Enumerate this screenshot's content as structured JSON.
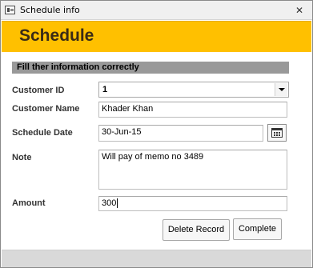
{
  "window": {
    "title": "Schedule info",
    "close_glyph": "✕"
  },
  "header": {
    "title": "Schedule"
  },
  "section": {
    "title": "Fill ther information correctly"
  },
  "form": {
    "customer_id": {
      "label": "Customer ID",
      "value": "1"
    },
    "customer_name": {
      "label": "Customer  Name",
      "value": "Khader Khan"
    },
    "schedule_date": {
      "label": "Schedule Date",
      "value": "30-Jun-15"
    },
    "note": {
      "label": "Note",
      "value": "Will pay of memo no 3489"
    },
    "amount": {
      "label": "Amount",
      "value": "300"
    }
  },
  "buttons": {
    "delete_label": "Delete Record",
    "complete_label": "Complete"
  },
  "colors": {
    "header_bg": "#ffc000",
    "section_bg": "#999999",
    "footer_bg": "#d9d9d9"
  },
  "icons": {
    "window": "form-icon",
    "close": "close-icon",
    "dropdown": "chevron-down-icon",
    "calendar": "calendar-icon"
  }
}
